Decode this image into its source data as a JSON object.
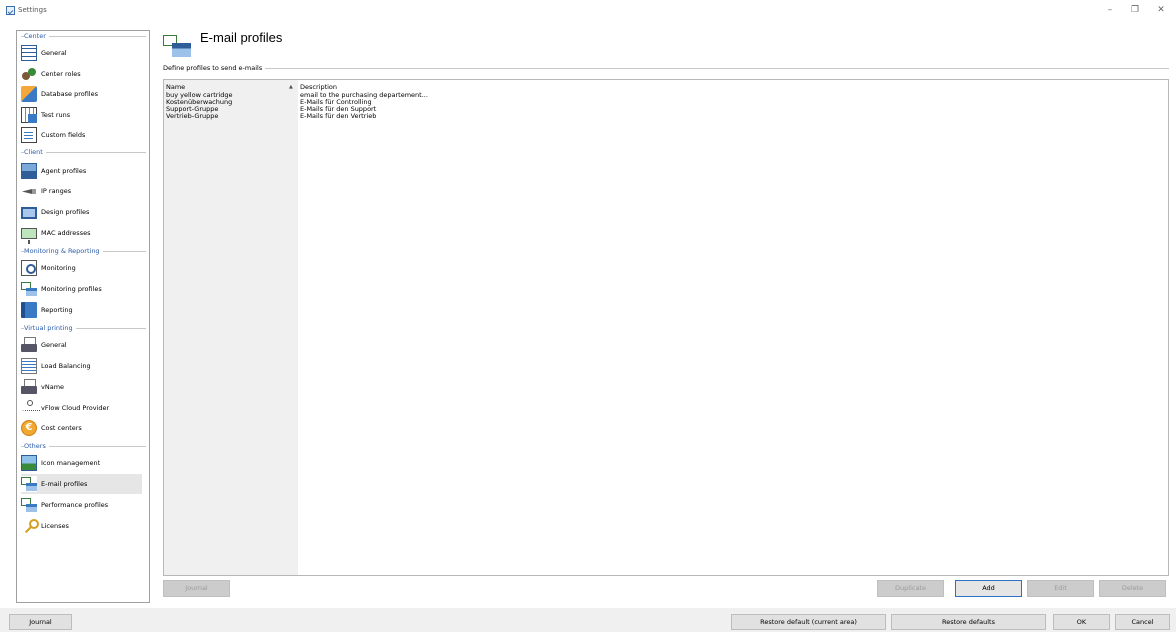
{
  "window": {
    "title": "Settings",
    "minimize_label": "–",
    "maximize_label": "❐",
    "close_label": "✕"
  },
  "sidebar": {
    "sections": [
      {
        "title": "Center",
        "items": [
          {
            "label": "General",
            "icon": "grid-icon"
          },
          {
            "label": "Center roles",
            "icon": "people-icon"
          },
          {
            "label": "Database profiles",
            "icon": "database-icon"
          },
          {
            "label": "Test runs",
            "icon": "calendar-icon"
          },
          {
            "label": "Custom fields",
            "icon": "document-icon"
          }
        ]
      },
      {
        "title": "Client",
        "items": [
          {
            "label": "Agent profiles",
            "icon": "agent-icon"
          },
          {
            "label": "IP ranges",
            "icon": "cable-icon"
          },
          {
            "label": "Design profiles",
            "icon": "monitor-icon"
          },
          {
            "label": "MAC addresses",
            "icon": "network-card-icon"
          }
        ]
      },
      {
        "title": "Monitoring & Reporting",
        "items": [
          {
            "label": "Monitoring",
            "icon": "monitoring-icon"
          },
          {
            "label": "Monitoring profiles",
            "icon": "monitoring-profile-icon"
          },
          {
            "label": "Reporting",
            "icon": "book-icon"
          }
        ]
      },
      {
        "title": "Virtual printing",
        "items": [
          {
            "label": "General",
            "icon": "printer-icon"
          },
          {
            "label": "Load Balancing",
            "icon": "load-balancing-icon"
          },
          {
            "label": "vName",
            "icon": "printer-icon"
          },
          {
            "label": "vFlow Cloud Provider",
            "icon": "network-icon"
          },
          {
            "label": "Cost centers",
            "icon": "coin-icon"
          }
        ]
      },
      {
        "title": "Others",
        "items": [
          {
            "label": "Icon management",
            "icon": "image-icon"
          },
          {
            "label": "E-mail profiles",
            "icon": "email-profile-icon",
            "selected": true
          },
          {
            "label": "Performance profiles",
            "icon": "performance-icon"
          },
          {
            "label": "Licenses",
            "icon": "key-icon"
          }
        ]
      }
    ]
  },
  "main": {
    "title": "E-mail profiles",
    "group_label": "Define profiles to send e-mails",
    "columns": [
      "Name",
      "Description"
    ],
    "sort_indicator": "▲",
    "rows": [
      {
        "name": "buy yellow cartridge",
        "description": "email to the purchasing departement..."
      },
      {
        "name": "Kostenüberwachung",
        "description": "E-Mails für Controlling"
      },
      {
        "name": "Support-Gruppe",
        "description": "E-Mails für den Support"
      },
      {
        "name": "Vertrieb-Gruppe",
        "description": "E-Mails für den Vertrieb"
      }
    ],
    "buttons": {
      "journal": "Journal",
      "duplicate": "Duplicate",
      "add": "Add",
      "edit": "Edit",
      "delete": "Delete"
    }
  },
  "footer": {
    "journal": "Journal",
    "restore_current": "Restore default (current area)",
    "restore_all": "Restore defaults",
    "ok": "OK",
    "cancel": "Cancel"
  },
  "colors": {
    "accent": "#2a72c8",
    "section_title": "#2a5ba8",
    "selected_item": "#e6e6e6"
  }
}
